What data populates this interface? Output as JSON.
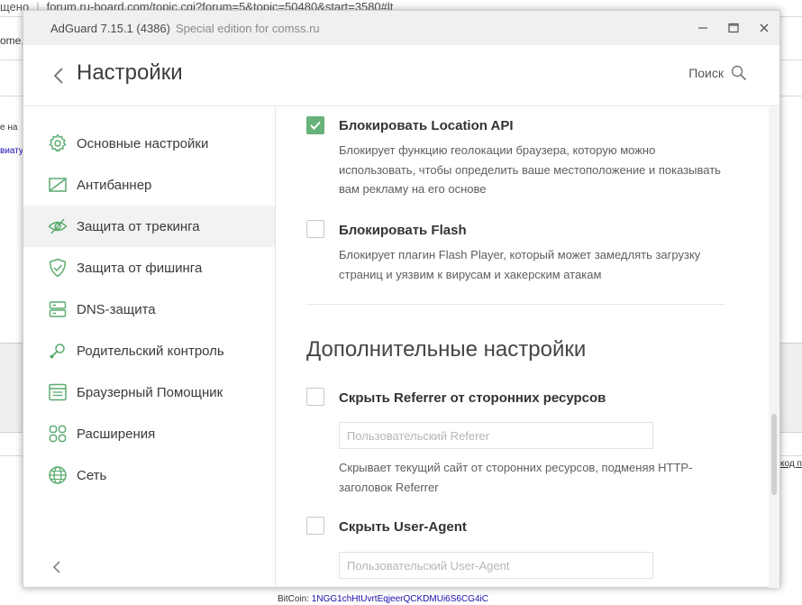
{
  "background": {
    "url_prefix": "щено",
    "url": "forum.ru-board.com/topic.cgi?forum=5&topic=50480&start=3580#lt",
    "left_text_1": "ome,",
    "left_text_2": "е на",
    "left_text_3": "виату",
    "right_text": "код п",
    "footer_label": "BitCoin:",
    "footer_address": "1NGG1chHtUvrtEqjeerQCKDMUi6S6CG4iC"
  },
  "window": {
    "app_name": "AdGuard 7.15.1 (4386)",
    "edition": "Special edition for comss.ru"
  },
  "header": {
    "title": "Настройки",
    "search_label": "Поиск"
  },
  "sidebar": {
    "items": [
      {
        "label": "Основные настройки",
        "icon": "gear-icon"
      },
      {
        "label": "Антибаннер",
        "icon": "antibanner-icon"
      },
      {
        "label": "Защита от трекинга",
        "icon": "eye-crossed-icon",
        "active": true
      },
      {
        "label": "Защита от фишинга",
        "icon": "shield-check-icon"
      },
      {
        "label": "DNS-защита",
        "icon": "server-icon"
      },
      {
        "label": "Родительский контроль",
        "icon": "rattle-icon"
      },
      {
        "label": "Браузерный Помощник",
        "icon": "browser-window-icon"
      },
      {
        "label": "Расширения",
        "icon": "grid-icon"
      },
      {
        "label": "Сеть",
        "icon": "globe-icon"
      }
    ]
  },
  "settings": {
    "location": {
      "title": "Блокировать Location API",
      "checked": true,
      "description": "Блокирует функцию геолокации браузера, которую можно использовать, чтобы определить ваше местоположение и показывать вам рекламу на его основе"
    },
    "flash": {
      "title": "Блокировать Flash",
      "checked": false,
      "description": "Блокирует плагин Flash Player, который может замедлять загрузку страниц и уязвим к вирусам и хакерским атакам"
    },
    "section_title": "Дополнительные настройки",
    "referrer": {
      "title": "Скрыть Referrer от сторонних ресурсов",
      "checked": false,
      "placeholder": "Пользовательский Referer",
      "description": "Скрывает текущий сайт от сторонних ресурсов, подменяя HTTP-заголовок Referrer"
    },
    "useragent": {
      "title": "Скрыть User-Agent",
      "checked": false,
      "placeholder": "Пользовательский User-Agent"
    }
  },
  "colors": {
    "accent_green": "#67b279",
    "icon_green": "#5aab6e"
  }
}
